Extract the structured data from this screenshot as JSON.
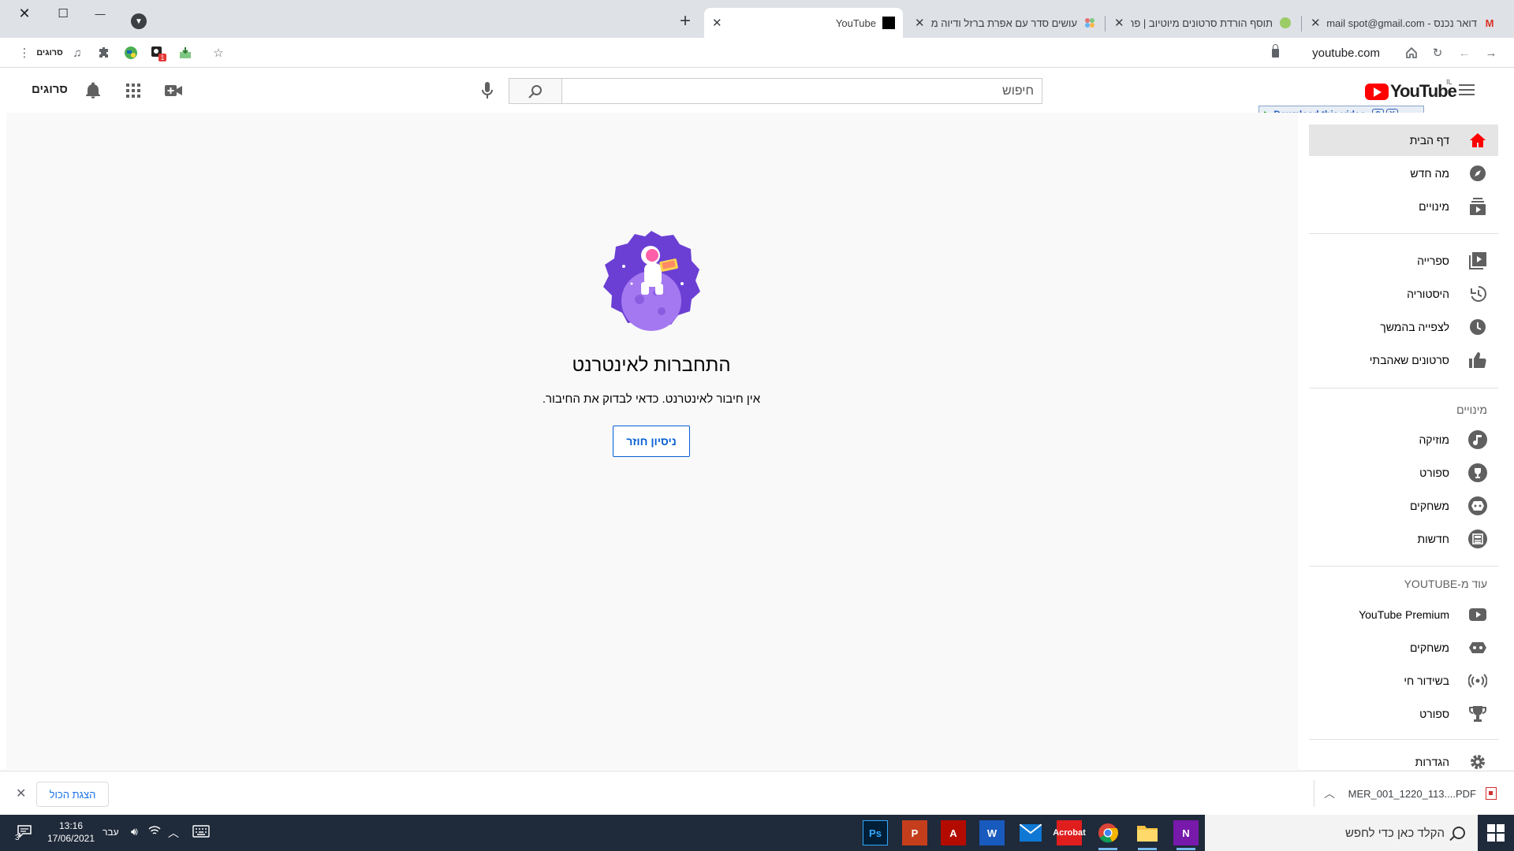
{
  "browser": {
    "tabs": [
      {
        "title": "דואר נכנס - Gmail ‎spot@gmail.com",
        "active": false
      },
      {
        "title": "תוסף הורדת סרטונים מיוטיוב | פרוג...",
        "active": false
      },
      {
        "title": "עושים סדר עם אפרת ברזל ודיוה מאיר",
        "active": false
      },
      {
        "title": "YouTube",
        "active": true
      }
    ],
    "url": "youtube.com",
    "window_buttons": {
      "close": "✕",
      "maximize": "☐",
      "minimize": "—"
    }
  },
  "masthead": {
    "logo_text": "YouTube",
    "country_code": "IL",
    "search_placeholder": "חיפוש",
    "avatar_text": "סרוגים"
  },
  "download_helper": {
    "label": "Download this video",
    "help": "?",
    "close": "X"
  },
  "error": {
    "title": "התחברות לאינטרנט",
    "message": "אין חיבור לאינטרנט. כדאי לבדוק את החיבור.",
    "retry_label": "ניסיון חוזר"
  },
  "sidebar": {
    "main": [
      {
        "label": "דף הבית",
        "icon": "home-icon",
        "active": true
      },
      {
        "label": "מה חדש",
        "icon": "explore-icon"
      },
      {
        "label": "מינויים",
        "icon": "subscriptions-icon"
      }
    ],
    "library": [
      {
        "label": "ספרייה",
        "icon": "library-icon"
      },
      {
        "label": "היסטוריה",
        "icon": "history-icon"
      },
      {
        "label": "לצפייה בהמשך",
        "icon": "watch-later-icon"
      },
      {
        "label": "סרטונים שאהבתי",
        "icon": "like-icon"
      }
    ],
    "subscriptions_heading": "מינויים",
    "subscriptions": [
      {
        "label": "מוזיקה",
        "icon": "music-icon"
      },
      {
        "label": "ספורט",
        "icon": "sports-icon"
      },
      {
        "label": "משחקים",
        "icon": "gaming-icon"
      },
      {
        "label": "חדשות",
        "icon": "news-icon"
      }
    ],
    "more_heading": "עוד מ-YOUTUBE",
    "more": [
      {
        "label": "YouTube Premium",
        "icon": "premium-icon"
      },
      {
        "label": "משחקים",
        "icon": "gaming-controller-icon"
      },
      {
        "label": "בשידור חי",
        "icon": "live-icon"
      },
      {
        "label": "ספורט",
        "icon": "trophy-icon"
      }
    ],
    "settings": {
      "label": "הגדרות",
      "icon": "settings-icon"
    }
  },
  "download_bar": {
    "file_name": "MER_001_1220_113....PDF",
    "show_all": "הצגת הכול",
    "close": "✕"
  },
  "taskbar": {
    "search_placeholder": "הקלד כאן כדי לחפש",
    "time": "13:16",
    "date": "17/06/2021",
    "language": "עבר",
    "notification_count": "3",
    "apps": [
      "Ps",
      "P",
      "A",
      "W",
      "Mail",
      "Acrobat",
      "Chrome",
      "Explorer",
      "N"
    ]
  },
  "colors": {
    "brand_red": "#ff0000",
    "link_blue": "#065fd4",
    "illustration_purple": "#6b3fd4"
  }
}
